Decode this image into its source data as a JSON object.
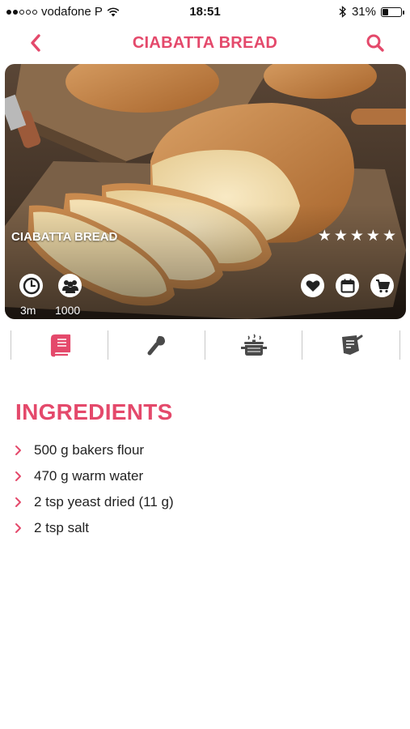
{
  "status": {
    "carrier": "vodafone P",
    "time": "18:51",
    "battery": "31%",
    "battery_level": 0.31
  },
  "nav": {
    "title": "CIABATTA BREAD",
    "back_icon": "chevron-left-icon",
    "search_icon": "search-icon"
  },
  "colors": {
    "accent": "#e4496b",
    "text": "#222222"
  },
  "hero": {
    "title": "CIABATTA BREAD",
    "rating": 5,
    "time_label": "3m",
    "servings_label": "1000"
  },
  "tabs": [
    {
      "icon": "book-icon"
    },
    {
      "icon": "whisk-icon"
    },
    {
      "icon": "pot-icon"
    },
    {
      "icon": "note-icon"
    }
  ],
  "ingredients": {
    "title": "INGREDIENTS",
    "items": [
      "500 g bakers flour",
      "470 g warm water",
      "2 tsp yeast dried (11 g)",
      "2 tsp salt"
    ]
  }
}
